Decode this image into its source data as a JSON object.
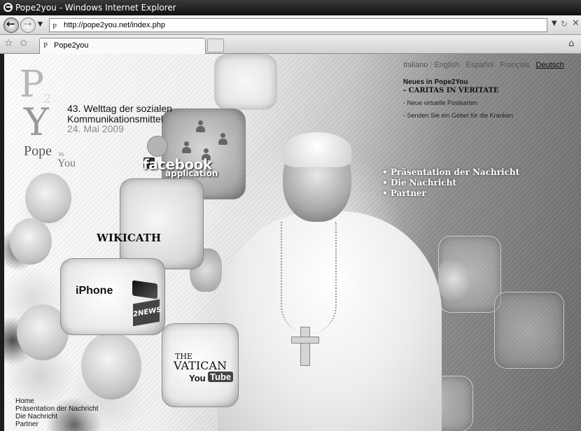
{
  "window": {
    "title": "Pope2you - Windows Internet Explorer"
  },
  "addressbar": {
    "url": "http://pope2you.net/index.php",
    "favicon": "P"
  },
  "tabbar": {
    "tab_title": "Pope2you",
    "favicon": "P"
  },
  "logo": {
    "pope": "Pope",
    "to": "to",
    "you": "You",
    "p": "P",
    "two": "2",
    "y": "Y"
  },
  "event": {
    "line1": "43. Welttag der sozialen",
    "line2": "Kommunikationsmittel",
    "date": "24. Mai 2009"
  },
  "languages": {
    "it": "Italiano",
    "en": "English",
    "es": "Español",
    "fr": "Français",
    "de": "Deutsch",
    "sep": "|"
  },
  "news": {
    "title": "Neues in Pope2You",
    "caritas": "- CARITAS IN VERITATE",
    "postcards": "- Neue virtuelle Postkarten",
    "prayer": "- Senden Sie ein Gebet für die Kranken"
  },
  "main_menu": [
    "Präsentation der Nachricht",
    "Die Nachricht",
    "Partner"
  ],
  "apps": {
    "facebook": "facebook",
    "facebook_sub": "application",
    "wikicath": "WIKICATH",
    "iphone": "iPhone",
    "h2n": "2NEWS",
    "vatican_the": "THE",
    "vatican": "VATICAN",
    "youtube_you": "You",
    "youtube_tube": "Tube"
  },
  "bottom_nav": [
    "Home",
    "Präsentation der Nachricht",
    "Die Nachricht",
    "Partner"
  ],
  "icons": {
    "back": "back-arrow-icon",
    "forward": "forward-arrow-icon",
    "refresh": "refresh-icon",
    "stop": "stop-icon",
    "favorites": "favorites-star-icon",
    "add_favorites": "add-favorites-icon",
    "home": "home-icon"
  }
}
